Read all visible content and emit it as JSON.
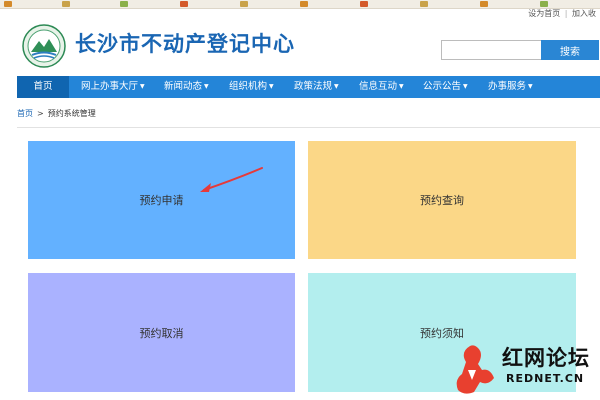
{
  "top_links": {
    "set_homepage": "设为首页",
    "separator": "|",
    "add_favorite": "加入收"
  },
  "header": {
    "title": "长沙市不动产登记中心"
  },
  "search": {
    "placeholder": "",
    "button_label": "搜索"
  },
  "nav": {
    "items": [
      {
        "label": "首页",
        "dropdown": false,
        "active": true
      },
      {
        "label": "网上办事大厅",
        "dropdown": true
      },
      {
        "label": "新闻动态",
        "dropdown": true
      },
      {
        "label": "组织机构",
        "dropdown": true
      },
      {
        "label": "政策法规",
        "dropdown": true
      },
      {
        "label": "信息互动",
        "dropdown": true
      },
      {
        "label": "公示公告",
        "dropdown": true
      },
      {
        "label": "办事服务",
        "dropdown": true
      }
    ],
    "caret": "▼"
  },
  "breadcrumb": {
    "home": "首页",
    "separator": ">",
    "current": "预约系统管理"
  },
  "tiles": [
    {
      "label": "预约申请",
      "color": "#63b1ff"
    },
    {
      "label": "预约查询",
      "color": "#fbd787"
    },
    {
      "label": "预约取消",
      "color": "#aab2ff"
    },
    {
      "label": "预约须知",
      "color": "#b3eeee"
    }
  ],
  "annotation": {
    "color": "#e63a3a",
    "points_to": "预约申请"
  },
  "watermark": {
    "cn": "红网论坛",
    "en": "REDNET.CN",
    "color": "#e8402f"
  },
  "colors": {
    "nav": "#2485d8",
    "nav_active": "#1065b0",
    "title": "#1a66b3",
    "search_button": "#2a86d4"
  }
}
